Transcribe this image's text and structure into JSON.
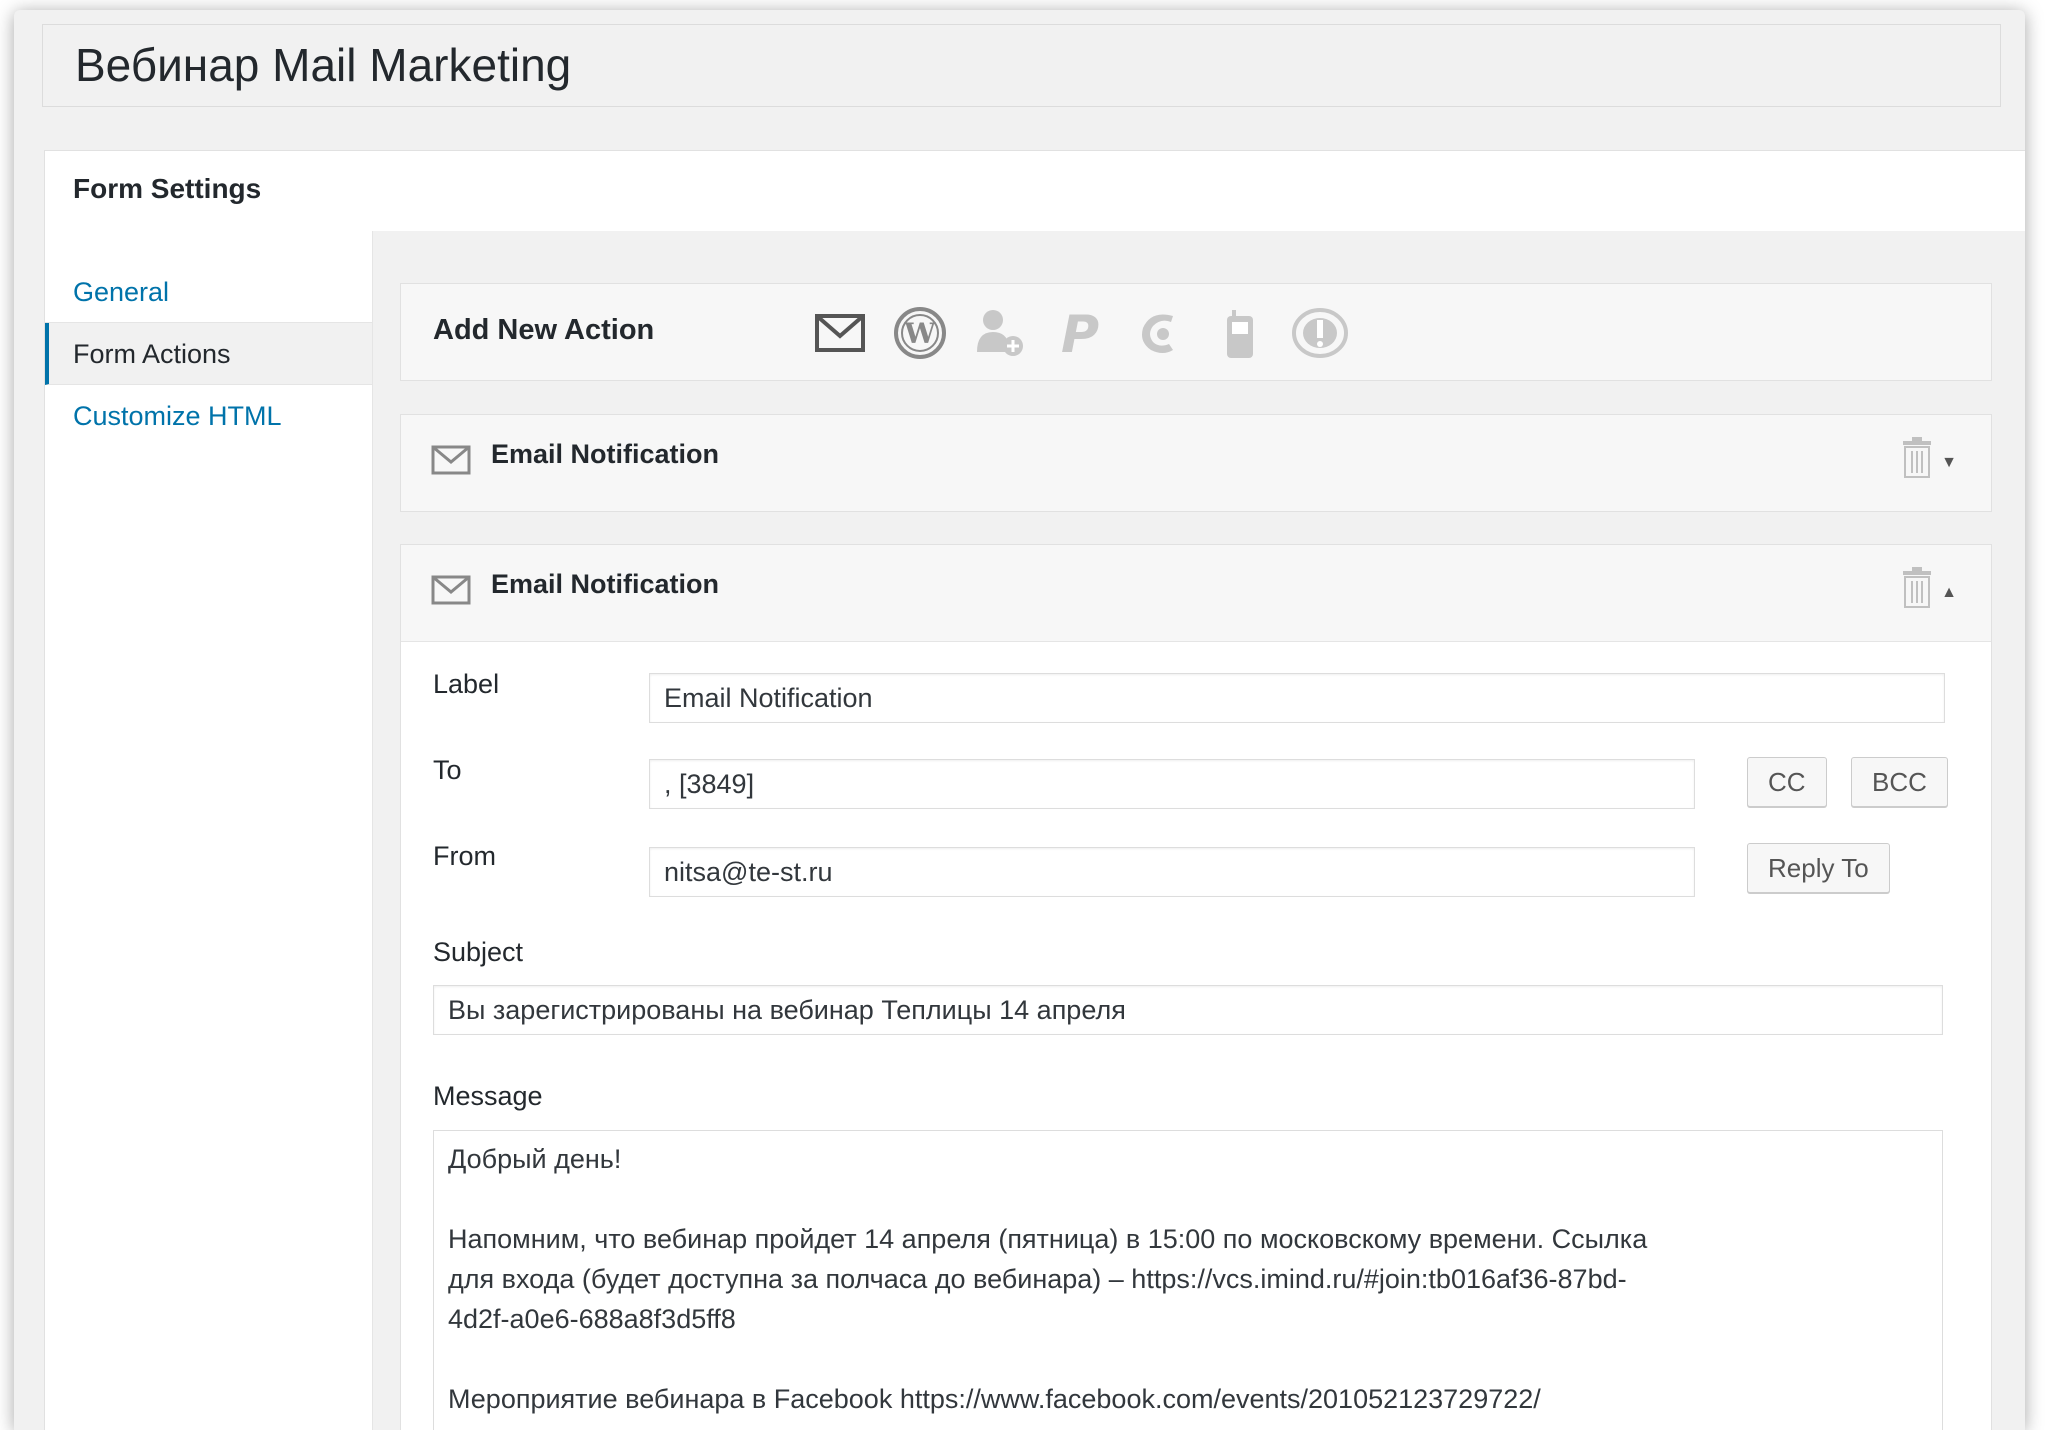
{
  "page": {
    "title": "Вебинар Mail Marketing"
  },
  "panel": {
    "header": "Form Settings"
  },
  "sidebar": {
    "items": [
      {
        "label": "General"
      },
      {
        "label": "Form Actions"
      },
      {
        "label": "Customize HTML"
      }
    ]
  },
  "add_action": {
    "label": "Add New Action",
    "icons": [
      "email-icon",
      "wordpress-icon",
      "add-user-icon",
      "paypal-icon",
      "mailchimp-icon",
      "mobile-icon",
      "aweber-icon"
    ]
  },
  "notifications": [
    {
      "title": "Email Notification",
      "state": "collapsed"
    },
    {
      "title": "Email Notification",
      "state": "expanded"
    }
  ],
  "email_form": {
    "label_label": "Label",
    "label_value": "Email Notification",
    "to_label": "To",
    "to_value": ", [3849]",
    "cc_button": "CC",
    "bcc_button": "BCC",
    "from_label": "From",
    "from_value": "nitsa@te-st.ru",
    "reply_to_button": "Reply To",
    "subject_label": "Subject",
    "subject_value": "Вы зарегистрированы на вебинар Теплицы 14 апреля",
    "message_label": "Message",
    "message_lines": {
      "greeting": "Добрый день!",
      "p1_l1": "Напомним, что вебинар пройдет 14 апреля (пятница) в 15:00 по московскому времени. Ссылка",
      "p1_l2": "для входа (будет доступна за полчаса до вебинара) – https://vcs.imind.ru/#join:tb016af36-87bd-",
      "p1_l3": "4d2f-a0e6-688a8f3d5ff8",
      "p2_l1": "Мероприятие вебинара в Facebook https://www.facebook.com/events/201052123729722/"
    }
  },
  "colors": {
    "link": "#0073aa",
    "text": "#23282d",
    "icon_gray": "#c8c8c8"
  }
}
